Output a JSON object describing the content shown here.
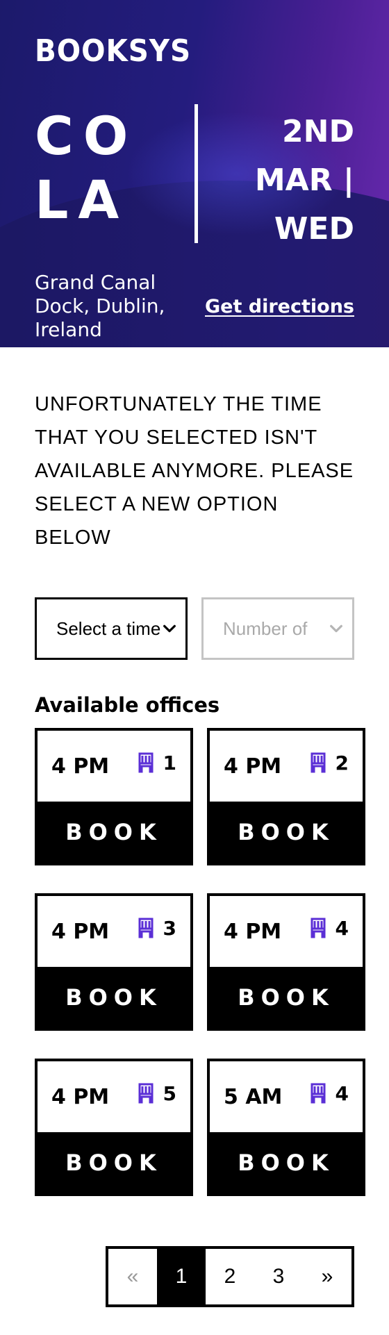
{
  "header": {
    "logo": "BOOKSYS",
    "venue": "COLA",
    "date": "2ND MAR | WED",
    "address": "Grand Canal Dock, Dublin, Ireland",
    "directions_label": "Get directions"
  },
  "notice": "UNFORTUNATELY THE TIME THAT YOU SELECTED ISN'T AVAILABLE ANYMORE. PLEASE SELECT A NEW OPTION BELOW",
  "filters": {
    "time_select": "Select a time",
    "count_select": "Number of"
  },
  "offices": {
    "title": "Available offices",
    "book_label": "BOOK",
    "items": [
      {
        "time": "4 PM",
        "seats": "1"
      },
      {
        "time": "4 PM",
        "seats": "2"
      },
      {
        "time": "4 PM",
        "seats": "3"
      },
      {
        "time": "4 PM",
        "seats": "4"
      },
      {
        "time": "4 PM",
        "seats": "5"
      },
      {
        "time": "5 AM",
        "seats": "4"
      }
    ]
  },
  "pagination": {
    "prev": "«",
    "pages": [
      "1",
      "2",
      "3"
    ],
    "next": "»",
    "current": "1"
  },
  "colors": {
    "accent": "#5b2fd6",
    "hero_dark": "#1c1a6b",
    "hero_purple": "#6a2ab0"
  }
}
